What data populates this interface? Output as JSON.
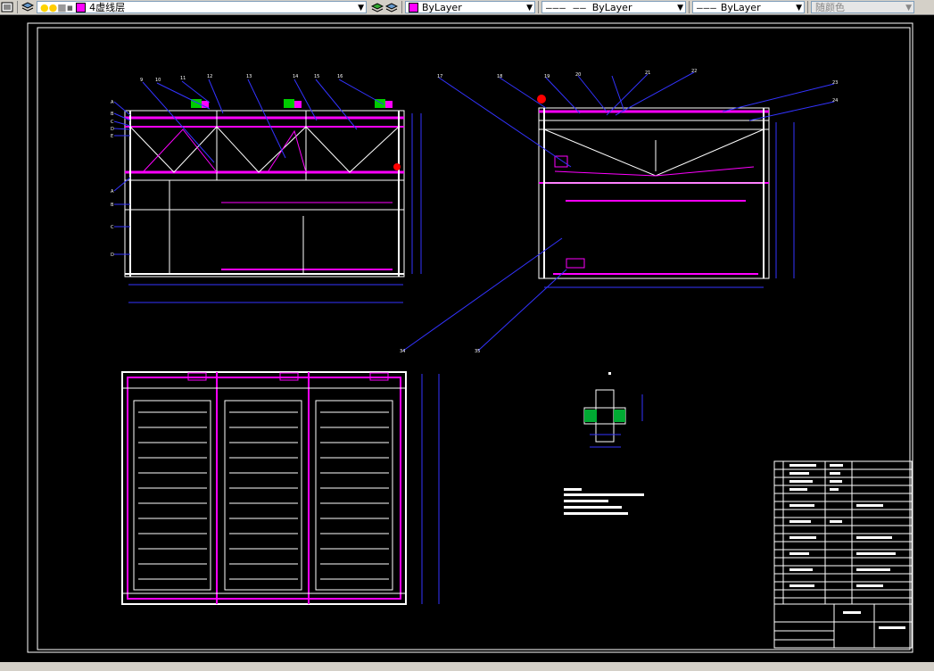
{
  "toolbar": {
    "layer_name": "4虚线层",
    "color_label": "ByLayer",
    "linetype_label": "ByLayer",
    "lineweight_label": "ByLayer",
    "plotstyle_label": "随颜色",
    "layer_color": "#ff00ff"
  },
  "drawing": {
    "balloon_labels_left": [
      "A",
      "B",
      "C",
      "D",
      "E",
      "A",
      "B",
      "C",
      "D"
    ],
    "balloon_labels_top": [
      "9",
      "10",
      "11",
      "12",
      "13",
      "14",
      "15",
      "16"
    ],
    "balloon_labels_right": [
      "17",
      "18",
      "19",
      "20",
      "21",
      "22",
      "23",
      "24"
    ],
    "balloon_labels_bottom": [
      "34",
      "35"
    ],
    "colors": {
      "frame": "#ffffff",
      "structure": "#ff00ff",
      "dimension": "#3333ff",
      "motor": "#00cc00",
      "highlight": "#ff0000",
      "annotation": "#ffffff"
    }
  }
}
